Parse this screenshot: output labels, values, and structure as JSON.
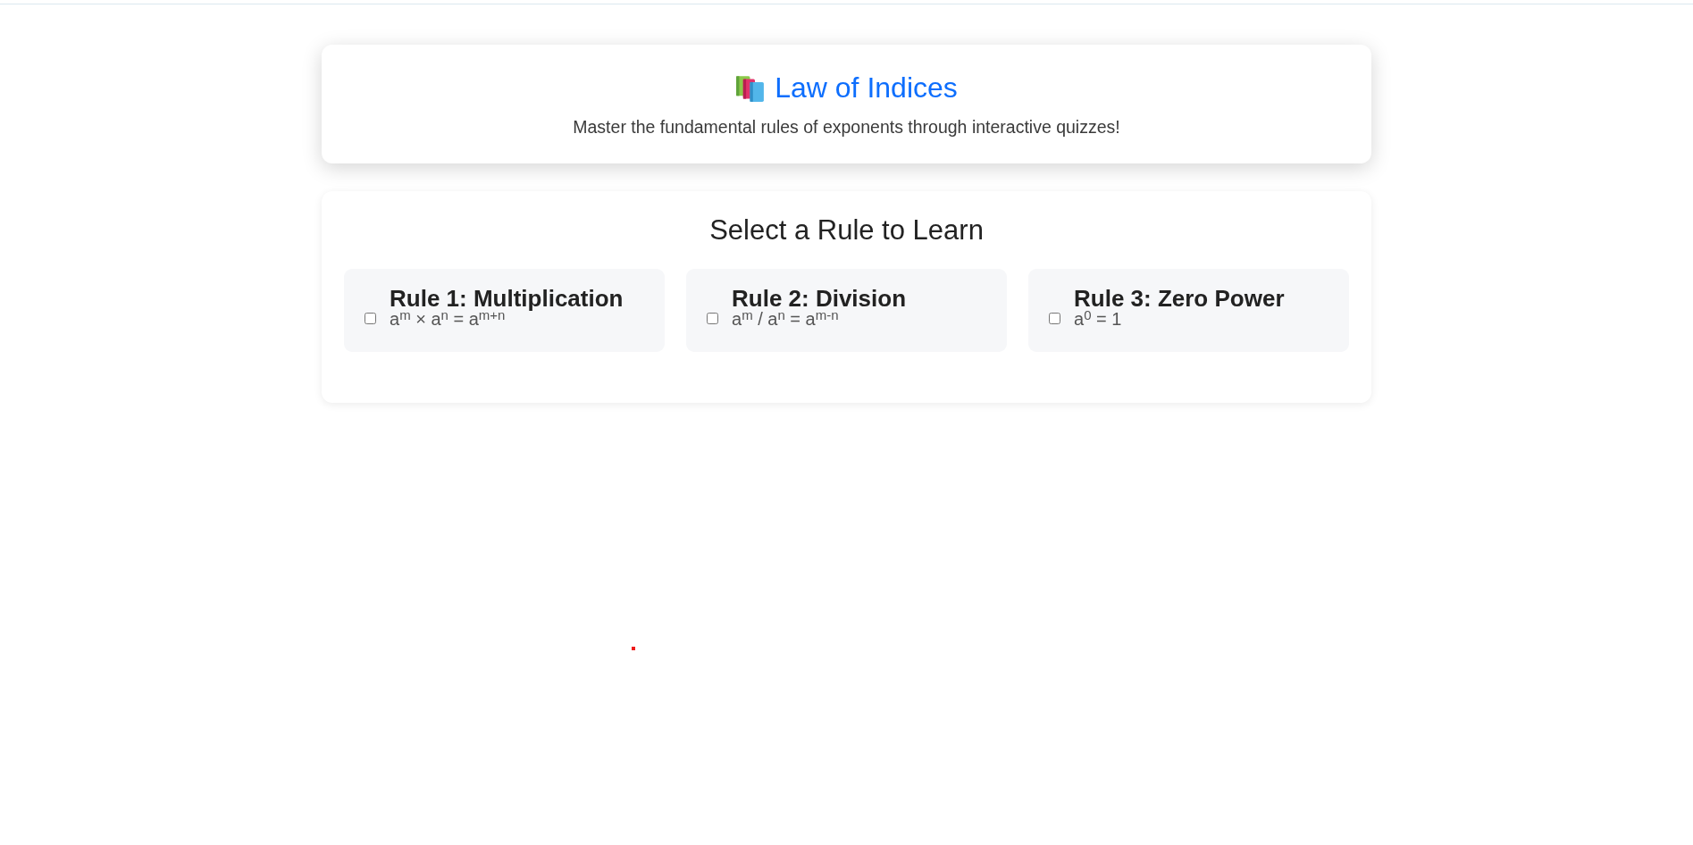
{
  "header": {
    "title": "Law of Indices",
    "subtitle": "Master the fundamental rules of exponents through interactive quizzes!"
  },
  "rule_selector": {
    "heading": "Select a Rule to Learn",
    "rules": [
      {
        "title": "Rule 1: Multiplication",
        "formula": "a$^{m}$ × a$^{n}$ = a$^{m+n}$",
        "checked": false
      },
      {
        "title": "Rule 2: Division",
        "formula": "a$^{m}$ / a$^{n}$ = a$^{m-n}$",
        "checked": false
      },
      {
        "title": "Rule 3: Zero Power",
        "formula": "a$^{0}$ = 1",
        "checked": false
      }
    ]
  }
}
